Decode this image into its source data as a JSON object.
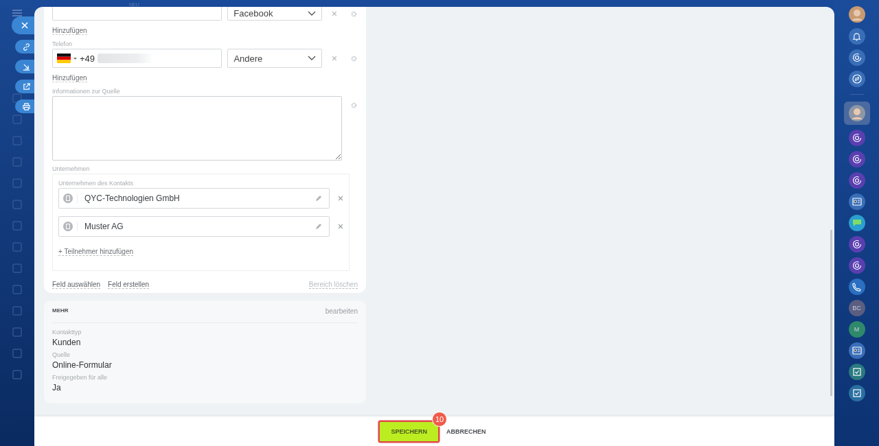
{
  "top_hint": "NEU",
  "form": {
    "email_row": {
      "type_value": "Facebook"
    },
    "add_link_1": "Hinzufügen",
    "phone": {
      "label": "Telefon",
      "prefix": "+49",
      "type_value": "Andere"
    },
    "add_link_2": "Hinzufügen",
    "source_info": {
      "label": "Informationen zur Quelle"
    },
    "companies": {
      "label": "Unternehmen",
      "inner_label": "Unternehmen des Kontakts",
      "items": [
        {
          "name": "QYC-Technologien GmbH"
        },
        {
          "name": "Muster AG"
        }
      ],
      "add_participant": "+ Teilnehmer hinzufügen"
    },
    "footer_links": [
      "Feld auswählen",
      "Feld erstellen"
    ],
    "clear_section": "Bereich löschen"
  },
  "more": {
    "title": "MEHR",
    "edit": "bearbeiten",
    "fields": [
      {
        "label": "Kontakttyp",
        "value": "Kunden"
      },
      {
        "label": "Quelle",
        "value": "Online-Formular"
      },
      {
        "label": "Freigegeben für alle",
        "value": "Ja"
      }
    ]
  },
  "bottom_bar": {
    "save": "SPEICHERN",
    "cancel": "ABBRECHEN",
    "badge": "10"
  },
  "right_bar": [
    {
      "kind": "user"
    },
    {
      "kind": "bell",
      "color": "#3a6fb8"
    },
    {
      "kind": "ring",
      "color": "#3a6fb8"
    },
    {
      "kind": "swap",
      "color": "#3a6fb8"
    },
    {
      "kind": "divider"
    },
    {
      "kind": "user-selected"
    },
    {
      "kind": "ring",
      "color": "#5a3fb0"
    },
    {
      "kind": "ring",
      "color": "#5a3fb0"
    },
    {
      "kind": "ring",
      "color": "#5a3fb0"
    },
    {
      "kind": "card",
      "color": "#3a6fb8"
    },
    {
      "kind": "chat",
      "color": "#2a9fd0"
    },
    {
      "kind": "ring",
      "color": "#5a3fb0"
    },
    {
      "kind": "ring",
      "color": "#5a3fb0"
    },
    {
      "kind": "phone",
      "color": "#2a6fc0"
    },
    {
      "kind": "initials",
      "label": "BC",
      "color": "#5a5e80"
    },
    {
      "kind": "initials",
      "label": "M",
      "color": "#2e8a6a"
    },
    {
      "kind": "card",
      "color": "#3a6fb8"
    },
    {
      "kind": "check",
      "color": "#2a7a80"
    },
    {
      "kind": "check",
      "color": "#2a6fa0"
    }
  ]
}
